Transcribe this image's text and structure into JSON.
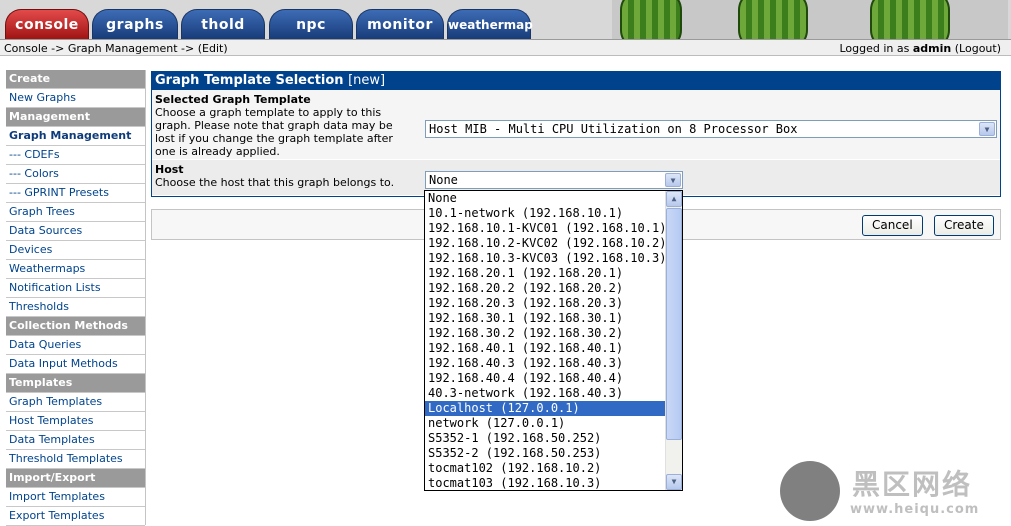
{
  "tabs": [
    {
      "label": "console",
      "active": true
    },
    {
      "label": "graphs"
    },
    {
      "label": "thold"
    },
    {
      "label": "npc"
    },
    {
      "label": "monitor"
    },
    {
      "label": "weathermap"
    }
  ],
  "breadcrumb": "Console -> Graph Management -> (Edit)",
  "login": {
    "prefix": "Logged in as ",
    "user": "admin",
    "logout": "(Logout)"
  },
  "sidebar": [
    {
      "type": "head",
      "label": "Create"
    },
    {
      "type": "item",
      "label": "New Graphs"
    },
    {
      "type": "head",
      "label": "Management"
    },
    {
      "type": "item",
      "label": "Graph Management",
      "selected": true
    },
    {
      "type": "item",
      "label": "--- CDEFs",
      "sub": true
    },
    {
      "type": "item",
      "label": "--- Colors",
      "sub": true
    },
    {
      "type": "item",
      "label": "--- GPRINT Presets",
      "sub": true
    },
    {
      "type": "item",
      "label": "Graph Trees"
    },
    {
      "type": "item",
      "label": "Data Sources"
    },
    {
      "type": "item",
      "label": "Devices"
    },
    {
      "type": "item",
      "label": "Weathermaps"
    },
    {
      "type": "item",
      "label": "Notification Lists"
    },
    {
      "type": "item",
      "label": "Thresholds"
    },
    {
      "type": "head",
      "label": "Collection Methods"
    },
    {
      "type": "item",
      "label": "Data Queries"
    },
    {
      "type": "item",
      "label": "Data Input Methods"
    },
    {
      "type": "head",
      "label": "Templates"
    },
    {
      "type": "item",
      "label": "Graph Templates"
    },
    {
      "type": "item",
      "label": "Host Templates"
    },
    {
      "type": "item",
      "label": "Data Templates"
    },
    {
      "type": "item",
      "label": "Threshold Templates"
    },
    {
      "type": "head",
      "label": "Import/Export"
    },
    {
      "type": "item",
      "label": "Import Templates"
    },
    {
      "type": "item",
      "label": "Export Templates"
    }
  ],
  "panel": {
    "title": "Graph Template Selection",
    "title_suffix": "[new]",
    "template": {
      "label": "Selected Graph Template",
      "description": "Choose a graph template to apply to this graph. Please note that graph data may be lost if you change the graph template after one is already applied.",
      "value": "Host MIB - Multi CPU Utilization on 8 Processor Box"
    },
    "host": {
      "label": "Host",
      "description": "Choose the host that this graph belongs to.",
      "value": "None"
    }
  },
  "buttons": {
    "cancel": "Cancel",
    "create": "Create"
  },
  "host_options": [
    "None",
    "10.1-network (192.168.10.1)",
    "192.168.10.1-KVC01 (192.168.10.1)",
    "192.168.10.2-KVC02 (192.168.10.2)",
    "192.168.10.3-KVC03 (192.168.10.3)",
    "192.168.20.1 (192.168.20.1)",
    "192.168.20.2 (192.168.20.2)",
    "192.168.20.3 (192.168.20.3)",
    "192.168.30.1 (192.168.30.1)",
    "192.168.30.2 (192.168.30.2)",
    "192.168.40.1 (192.168.40.1)",
    "192.168.40.3 (192.168.40.3)",
    "192.168.40.4 (192.168.40.4)",
    "40.3-network (192.168.40.3)",
    "Localhost (127.0.0.1)",
    "network (127.0.0.1)",
    "S5352-1 (192.168.50.252)",
    "S5352-2 (192.168.50.253)",
    "tocmat102 (192.168.10.2)",
    "tocmat103 (192.168.10.3)"
  ],
  "highlighted_option": "Localhost (127.0.0.1)",
  "watermark": {
    "text": "黑区网络",
    "url": "www.heiqu.com"
  },
  "colors": {
    "accent": "#00438c",
    "active_tab": "#c0272d",
    "highlight": "#316ac5"
  }
}
